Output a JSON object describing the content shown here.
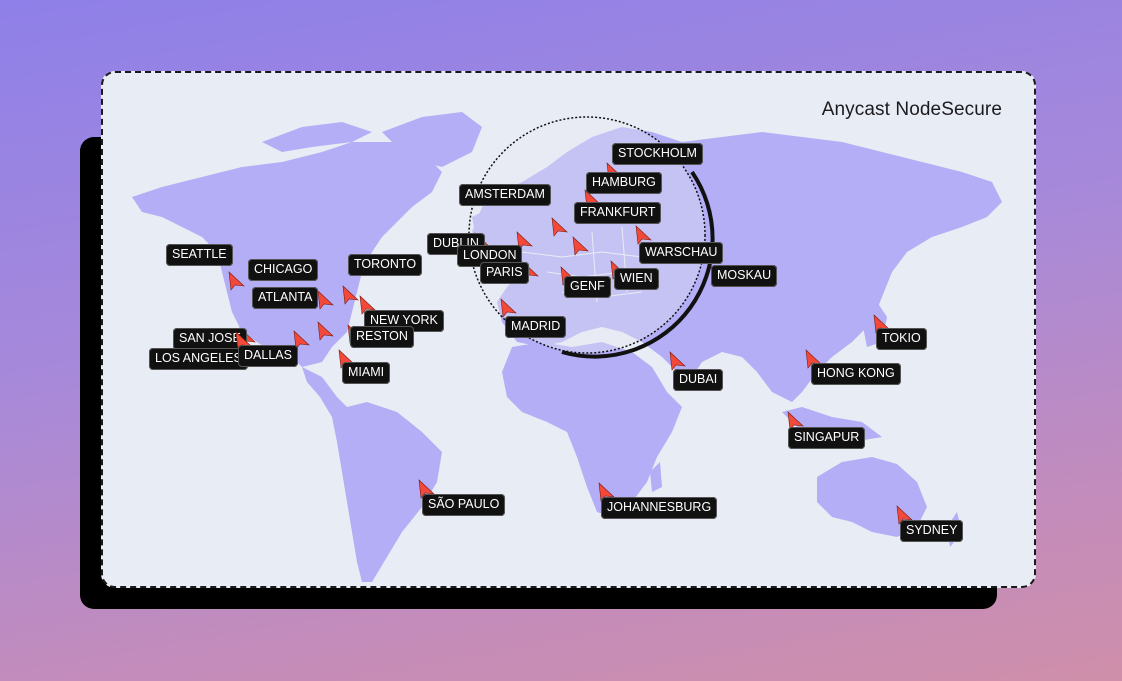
{
  "title": "Anycast NodeSecure",
  "colors": {
    "land": "#b3aef5",
    "ocean": "#e8ecf4",
    "marker": "#f2493a",
    "label_bg": "#111111"
  },
  "locations": [
    {
      "name": "SEATTLE",
      "marker": "pin-icon"
    },
    {
      "name": "CHICAGO",
      "marker": "pin-icon"
    },
    {
      "name": "TORONTO",
      "marker": "pin-icon"
    },
    {
      "name": "ATLANTA",
      "marker": "pin-icon"
    },
    {
      "name": "NEW YORK",
      "marker": "pin-icon"
    },
    {
      "name": "RESTON",
      "marker": "pin-icon"
    },
    {
      "name": "SAN JOSE",
      "marker": "pin-icon"
    },
    {
      "name": "LOS ANGELES",
      "marker": "pin-icon"
    },
    {
      "name": "DALLAS",
      "marker": "pin-icon"
    },
    {
      "name": "MIAMI",
      "marker": "pin-icon"
    },
    {
      "name": "SÃO PAULO",
      "marker": "pin-icon"
    },
    {
      "name": "DUBLIN",
      "marker": "pin-icon"
    },
    {
      "name": "LONDON",
      "marker": "pin-icon"
    },
    {
      "name": "PARIS",
      "marker": "pin-icon"
    },
    {
      "name": "AMSTERDAM",
      "marker": "pin-icon"
    },
    {
      "name": "MADRID",
      "marker": "pin-icon"
    },
    {
      "name": "STOCKHOLM",
      "marker": "pin-icon"
    },
    {
      "name": "HAMBURG",
      "marker": "pin-icon"
    },
    {
      "name": "FRANKFURT",
      "marker": "pin-icon"
    },
    {
      "name": "GENF",
      "marker": "pin-icon"
    },
    {
      "name": "WIEN",
      "marker": "pin-icon"
    },
    {
      "name": "WARSCHAU",
      "marker": "pin-icon"
    },
    {
      "name": "MOSKAU",
      "marker": "pin-icon"
    },
    {
      "name": "DUBAI",
      "marker": "pin-icon"
    },
    {
      "name": "JOHANNESBURG",
      "marker": "pin-icon"
    },
    {
      "name": "HONG KONG",
      "marker": "pin-icon"
    },
    {
      "name": "TOKIO",
      "marker": "pin-icon"
    },
    {
      "name": "SINGAPUR",
      "marker": "pin-icon"
    },
    {
      "name": "SYDNEY",
      "marker": "pin-icon"
    }
  ]
}
